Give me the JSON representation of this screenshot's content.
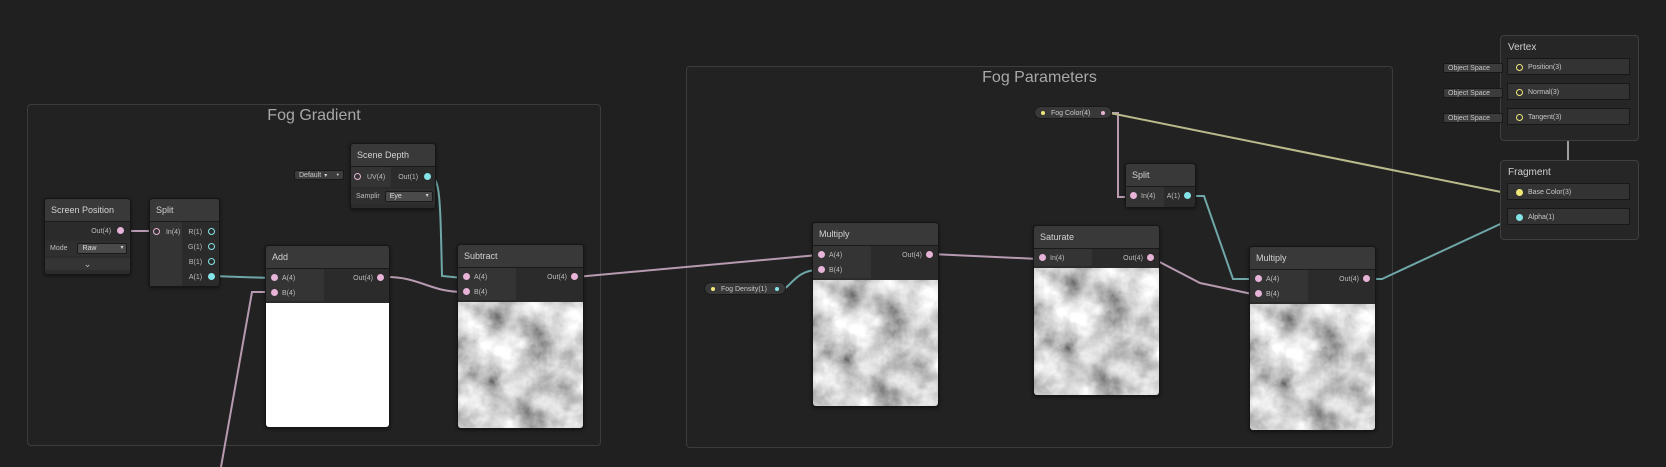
{
  "groups": {
    "fog_gradient": "Fog Gradient",
    "fog_parameters": "Fog Parameters"
  },
  "nodes": {
    "screen_position": {
      "title": "Screen Position",
      "out": "Out(4)",
      "mode_label": "Mode",
      "mode_value": "Raw"
    },
    "split_1": {
      "title": "Split",
      "in": "In(4)",
      "outs": [
        "R(1)",
        "G(1)",
        "B(1)",
        "A(1)"
      ]
    },
    "scene_depth": {
      "title": "Scene Depth",
      "uv": "UV(4)",
      "out": "Out(1)",
      "uv_default": "Default",
      "sampling_label": "Samplir",
      "sampling_value": "Eye"
    },
    "add": {
      "title": "Add",
      "a": "A(4)",
      "b": "B(4)",
      "out": "Out(4)"
    },
    "subtract": {
      "title": "Subtract",
      "a": "A(4)",
      "b": "B(4)",
      "out": "Out(4)"
    },
    "multiply_1": {
      "title": "Multiply",
      "a": "A(4)",
      "b": "B(4)",
      "out": "Out(4)"
    },
    "saturate": {
      "title": "Saturate",
      "in": "In(4)",
      "out": "Out(4)"
    },
    "split_2": {
      "title": "Split",
      "in": "In(4)",
      "out": "A(1)"
    },
    "multiply_2": {
      "title": "Multiply",
      "a": "A(4)",
      "b": "B(4)",
      "out": "Out(4)"
    }
  },
  "properties": {
    "fog_color": "Fog Color(4)",
    "fog_density": "Fog Density(1)"
  },
  "master_stack": {
    "vertex": {
      "title": "Vertex",
      "blocks": [
        "Position(3)",
        "Normal(3)",
        "Tangent(3)"
      ],
      "space_label": "Object Space"
    },
    "fragment": {
      "title": "Fragment",
      "blocks": [
        "Base Color(3)",
        "Alpha(1)"
      ]
    }
  },
  "colors": {
    "background": "#202020",
    "vector4_wire": "#b79ab0",
    "float_wire": "#6fa7a8",
    "vector3_wire": "#b9ba8c"
  }
}
